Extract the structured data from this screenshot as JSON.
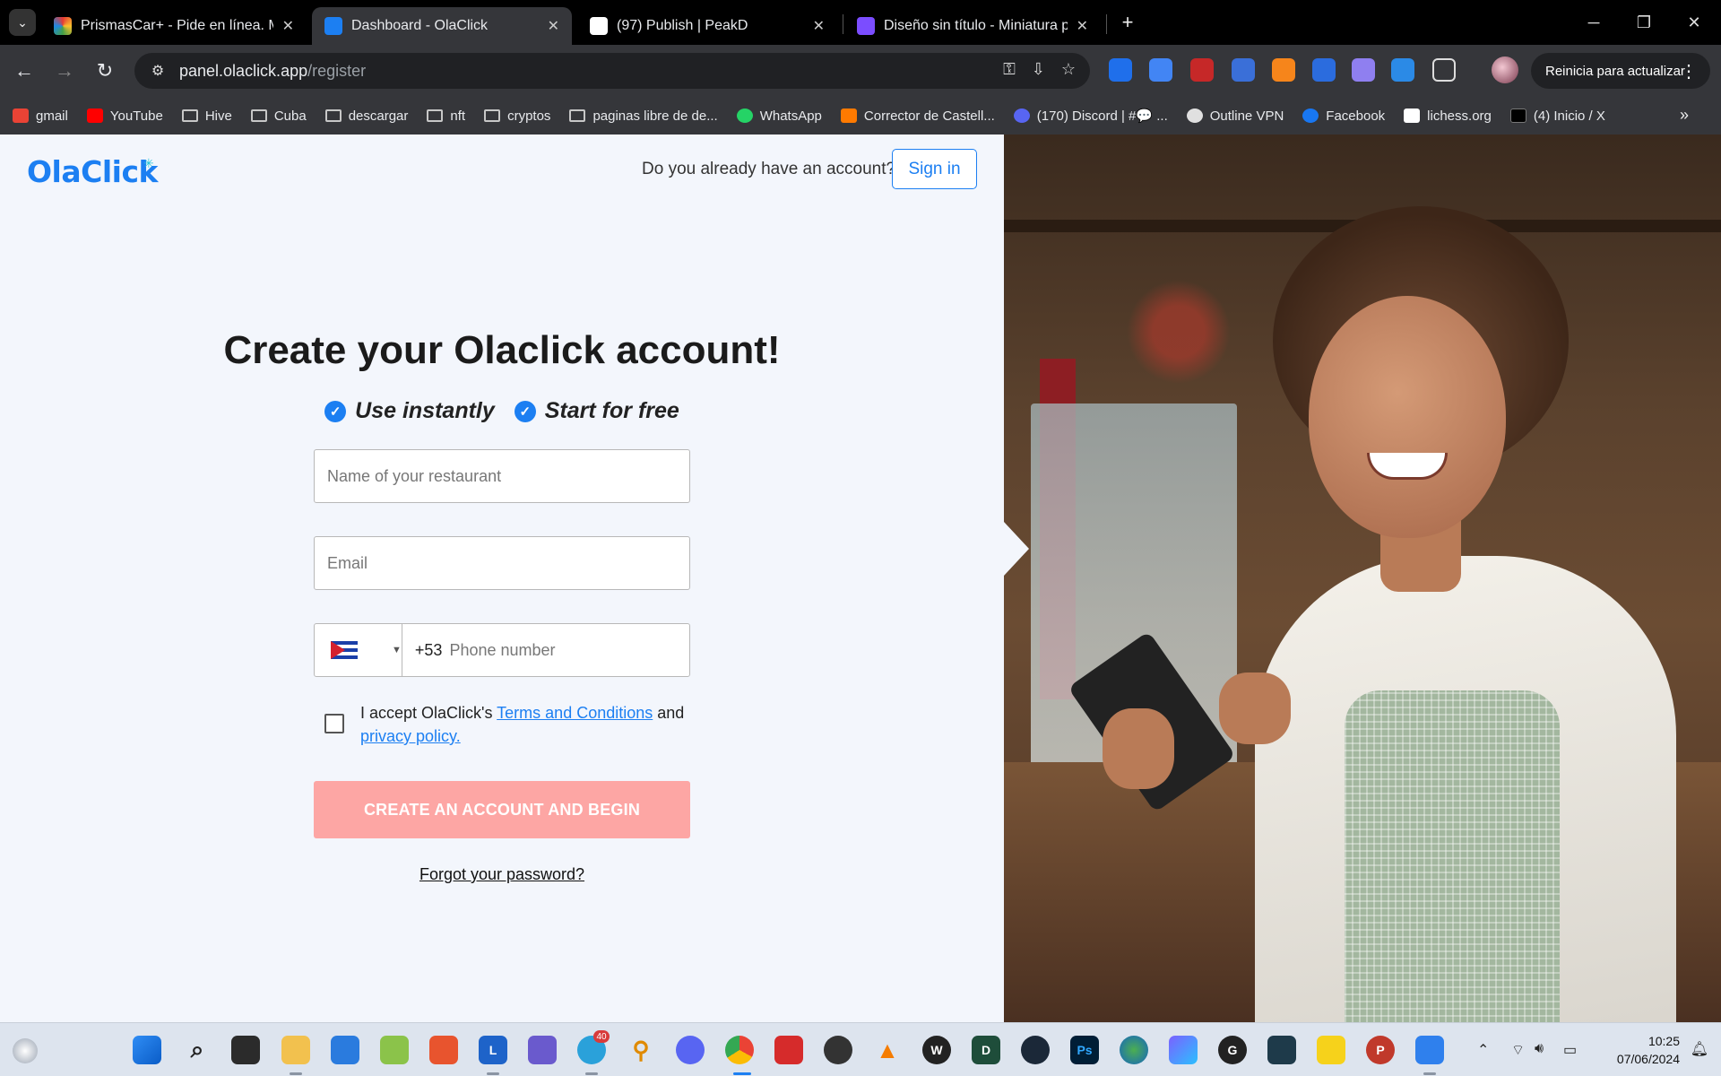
{
  "browser": {
    "tabs": [
      {
        "title": "PrismasCar+ - Pide en línea. Me",
        "favicon_color": "#e53935",
        "active": false
      },
      {
        "title": "Dashboard - OlaClick",
        "favicon_color": "#1c7ff2",
        "active": true
      },
      {
        "title": "(97) Publish | PeakD",
        "favicon_color": "#ffffff",
        "active": false
      },
      {
        "title": "Diseño sin título - Miniatura pa",
        "favicon_color": "#7b4dff",
        "active": false
      }
    ],
    "url_host": "panel.olaclick.app",
    "url_path": "/register",
    "update_button": "Reinicia para actualizar",
    "bookmarks": [
      {
        "label": "gmail",
        "type": "site",
        "color": "#ea4335"
      },
      {
        "label": "YouTube",
        "type": "site",
        "color": "#ff0000"
      },
      {
        "label": "Hive",
        "type": "folder"
      },
      {
        "label": "Cuba",
        "type": "folder"
      },
      {
        "label": "descargar",
        "type": "folder"
      },
      {
        "label": "nft",
        "type": "folder"
      },
      {
        "label": "cryptos",
        "type": "folder"
      },
      {
        "label": "paginas libre de de...",
        "type": "folder"
      },
      {
        "label": "WhatsApp",
        "type": "site",
        "color": "#25d366"
      },
      {
        "label": "Corrector de Castell...",
        "type": "site",
        "color": "#ff7a00"
      },
      {
        "label": "(170) Discord | #💬 ...",
        "type": "site",
        "color": "#5865f2"
      },
      {
        "label": "Outline VPN",
        "type": "site",
        "color": "#e0e0e0"
      },
      {
        "label": "Facebook",
        "type": "site",
        "color": "#1877f2"
      },
      {
        "label": "lichess.org",
        "type": "site",
        "color": "#ffffff"
      },
      {
        "label": "(4) Inicio / X",
        "type": "site",
        "color": "#000000"
      }
    ]
  },
  "page": {
    "logo": "OlaClick",
    "have_account": "Do you already have an account?",
    "sign_in": "Sign in",
    "title": "Create your Olaclick account!",
    "perks": [
      "Use instantly",
      "Start for free"
    ],
    "restaurant_placeholder": "Name of your restaurant",
    "email_placeholder": "Email",
    "dial_code": "+53",
    "phone_placeholder": "Phone number",
    "terms_prefix": "I accept OlaClick's",
    "terms_link": "Terms and Conditions",
    "terms_and": "and",
    "privacy_link": "privacy policy.",
    "cta": "CREATE AN ACCOUNT AND BEGIN",
    "forgot": "Forgot your password?",
    "brand_color": "#1c7ff2",
    "cta_color": "#fda6a4"
  },
  "taskbar": {
    "telegram_badge": "40",
    "time": "10:25",
    "date": "07/06/2024"
  }
}
